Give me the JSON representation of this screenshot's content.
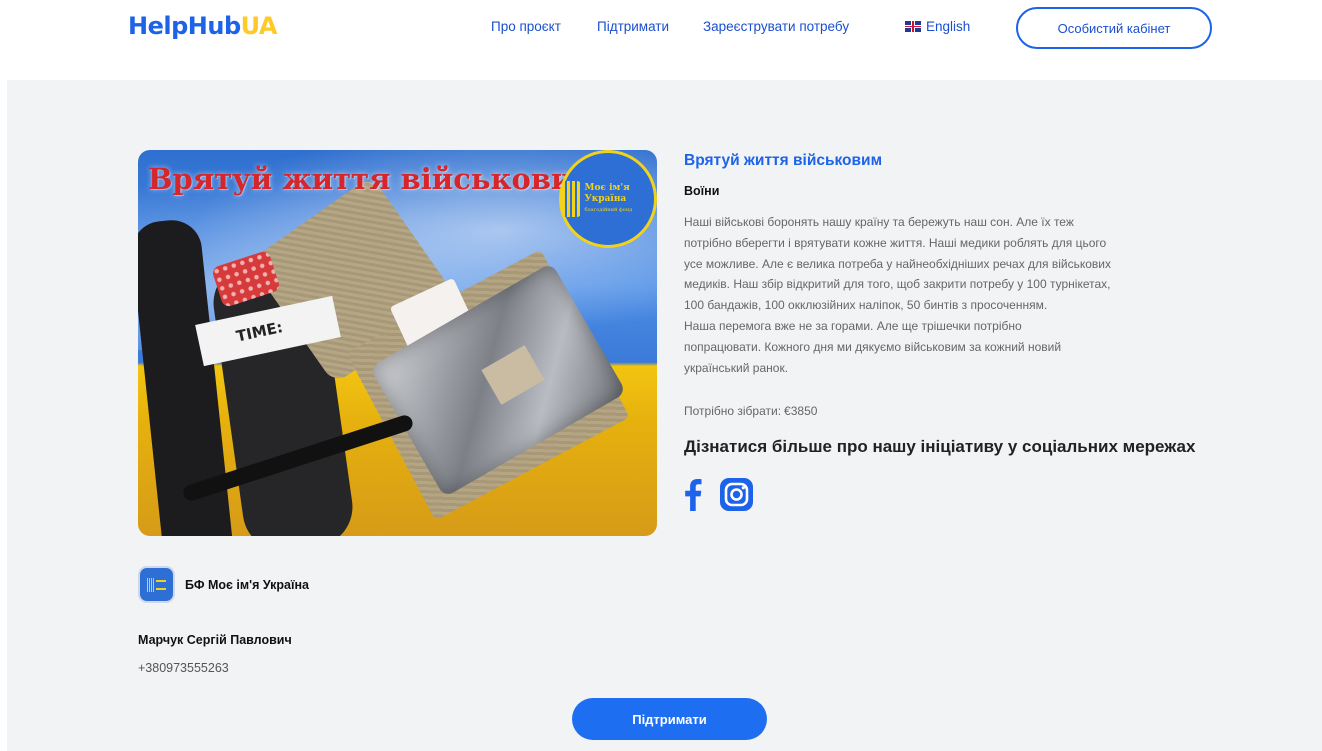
{
  "header": {
    "logo_main": "HelpHub",
    "logo_accent": "UA",
    "nav": [
      "Про проєкт",
      "Підтримати",
      "Зареєструвати потребу"
    ],
    "language": "English",
    "cabinet_button": "Особистий кабінет"
  },
  "need": {
    "image_title": "Врятуй життя військовим",
    "image_badge_title": "Моє ім'я Україна",
    "image_badge_subtitle": "благодійний фонд",
    "image_band_text": "TIME:",
    "title": "Врятуй життя військовим",
    "category": "Воїни",
    "description_lines": [
      "Наші військові боронять нашу країну та бережуть наш сон. Але їх теж",
      "потрібно вберегти і врятувати кожне життя. Наші медики роблять для цього",
      "усе можливе. Але є велика потреба у найнеобхідніших речах для військових",
      "медиків. Наш збір відкритий для того, щоб закрити потребу у 100 турнікетах,",
      "100 бандажів, 100 окклюзійних наліпок, 50 бинтів з просоченням.",
      "Наша перемога вже не за горами. Але ще трішечки потрібно",
      "попрацювати. Кожного дня ми дякуємо військовим за кожний новий",
      "український ранок."
    ],
    "goal_label": "Потрібно зібрати:",
    "goal_amount": "€3850",
    "social_title": "Дізнатися більше про нашу ініціативу у соціальних мережах"
  },
  "organization": {
    "name": "БФ Моє ім'я Україна"
  },
  "contact": {
    "name": "Марчук Сергій Павлович",
    "phone": "+380973555263"
  },
  "actions": {
    "support_button": "Підтримати"
  },
  "colors": {
    "primary": "#1d63ea",
    "accent": "#ffc928",
    "background": "#f2f3f5"
  }
}
